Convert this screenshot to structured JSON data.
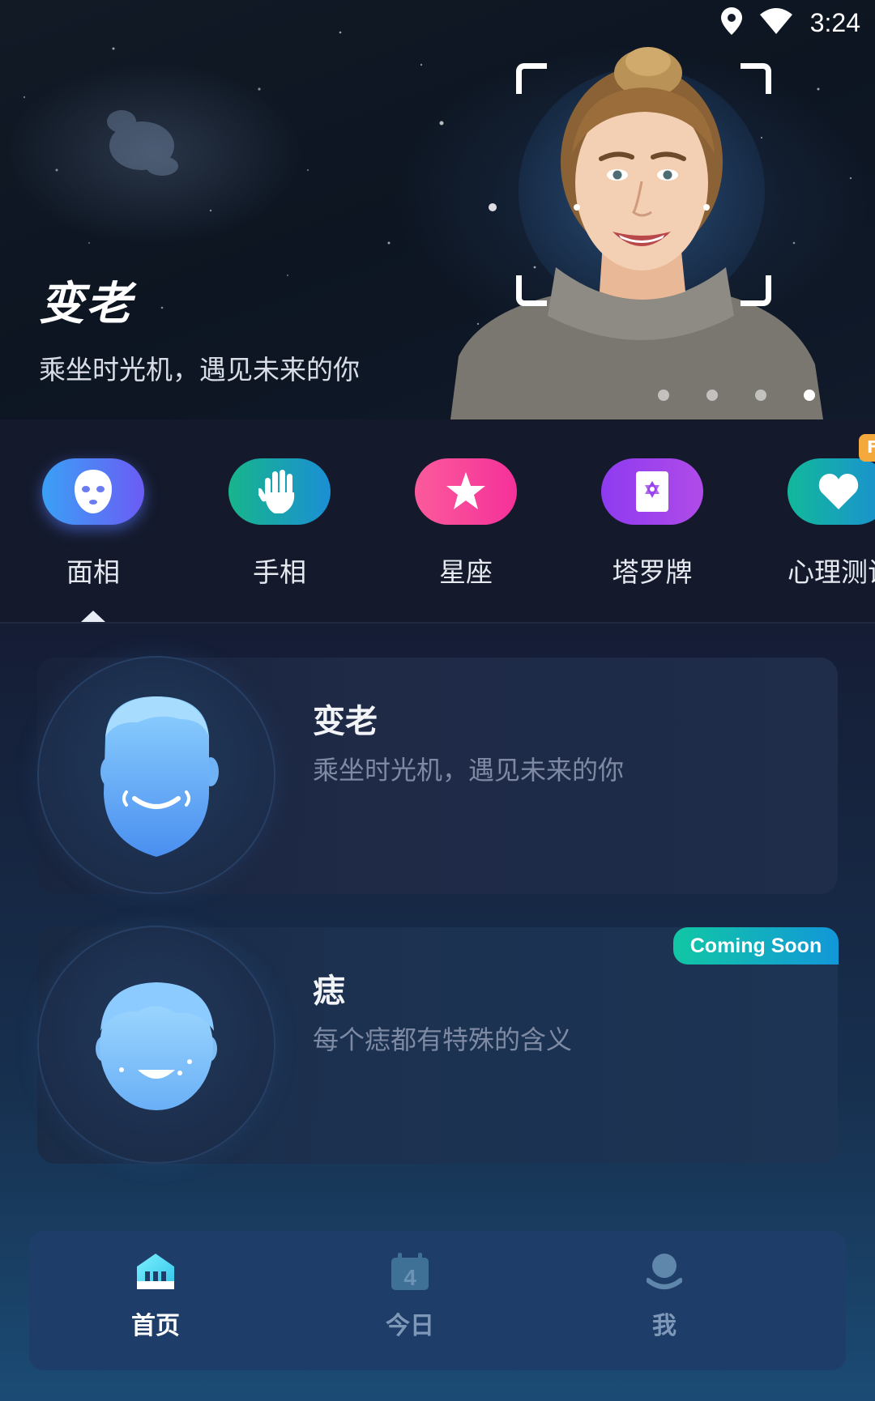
{
  "status_bar": {
    "time": "3:24"
  },
  "banner": {
    "title": "变老",
    "subtitle": "乘坐时光机，遇见未来的你",
    "page_count": 4,
    "active_page": 4
  },
  "categories": [
    {
      "label": "面相",
      "icon": "face-mask-icon",
      "selected": true
    },
    {
      "label": "手相",
      "icon": "palm-icon"
    },
    {
      "label": "星座",
      "icon": "star-icon"
    },
    {
      "label": "塔罗牌",
      "icon": "tarot-card-icon"
    },
    {
      "label": "心理测试",
      "icon": "heart-icon",
      "badge": "F"
    }
  ],
  "features": [
    {
      "title": "变老",
      "description": "乘坐时光机，遇见未来的你",
      "icon": "aging-face-icon"
    },
    {
      "title": "痣",
      "description": "每个痣都有特殊的含义",
      "icon": "mole-face-icon",
      "badge": "Coming Soon"
    }
  ],
  "bottom_nav": [
    {
      "label": "首页",
      "icon": "home-icon",
      "active": true
    },
    {
      "label": "今日",
      "icon": "calendar-icon",
      "icon_text": "4"
    },
    {
      "label": "我",
      "icon": "profile-icon"
    }
  ],
  "colors": {
    "accent_teal": "#11c7a4",
    "accent_blue": "#1297d9",
    "nav_background": "#1e3d68"
  }
}
